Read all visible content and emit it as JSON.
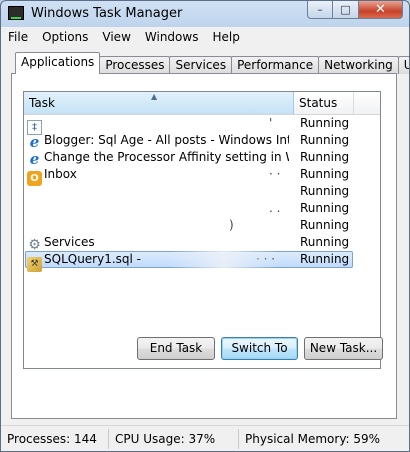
{
  "window": {
    "title": "Windows Task Manager"
  },
  "caption": {
    "minimize": "–",
    "maximize": "□",
    "close": "✕"
  },
  "menu": [
    "File",
    "Options",
    "View",
    "Windows",
    "Help"
  ],
  "tabs": [
    "Applications",
    "Processes",
    "Services",
    "Performance",
    "Networking",
    "Users"
  ],
  "list": {
    "columns": {
      "task": "Task",
      "status": "Status"
    },
    "rows": [
      {
        "task": "",
        "status": "Running",
        "icon": "doc-icon",
        "icon_glyph": "‡",
        "trail": "'"
      },
      {
        "task": "Blogger: Sql Age - All posts - Windows Internet ...",
        "status": "Running",
        "icon": "ie-icon",
        "icon_glyph": "e"
      },
      {
        "task": "Change the Processor Affinity setting in Window...",
        "status": "Running",
        "icon": "ie-icon",
        "icon_glyph": "e"
      },
      {
        "task": "Inbox",
        "status": "Running",
        "icon": "outlook-icon",
        "icon_glyph": "O",
        "trail": "· ·"
      },
      {
        "task": "",
        "status": "Running",
        "icon": "",
        "icon_glyph": ""
      },
      {
        "task": "",
        "status": "Running",
        "icon": "",
        "icon_glyph": "",
        "trail": ". ."
      },
      {
        "task": "",
        "status": "Running",
        "icon": "",
        "icon_glyph": "",
        "trail": ")"
      },
      {
        "task": "Services",
        "status": "Running",
        "icon": "gear-icon",
        "icon_glyph": "⚙"
      },
      {
        "task": "SQLQuery1.sql -",
        "status": "Running",
        "icon": "sql-icon",
        "icon_glyph": "⚒",
        "trail": "· · ·",
        "selected": true
      }
    ]
  },
  "buttons": {
    "end_task": "End Task",
    "switch_to": "Switch To",
    "new_task": "New Task..."
  },
  "status": {
    "processes": "Processes: 144",
    "cpu": "CPU Usage: 37%",
    "memory": "Physical Memory: 59%"
  }
}
